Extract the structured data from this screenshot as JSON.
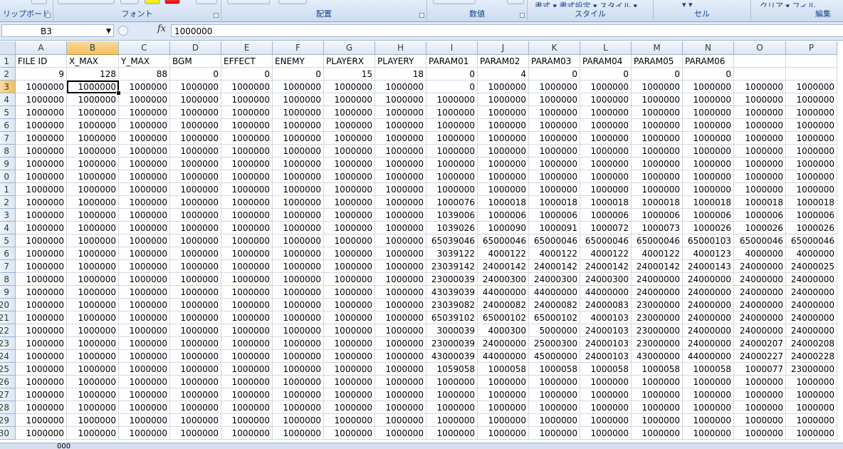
{
  "ribbon": {
    "groups": [
      {
        "label": "リップボード",
        "buttons": ""
      },
      {
        "label": "フォント",
        "buttons": ""
      },
      {
        "label": "配置",
        "buttons": ""
      },
      {
        "label": "数値",
        "buttons": ""
      },
      {
        "label": "スタイル",
        "buttons": "書式 ▾   書式設定 ▾  スタイル ▾"
      },
      {
        "label": "セル",
        "buttons": "▾          ▾"
      },
      {
        "label": "編集",
        "buttons": "クリア ▾          フィル"
      }
    ]
  },
  "formula_bar": {
    "name_box": "B3",
    "fx": "fx",
    "value": "1000000"
  },
  "sheet": {
    "columns": [
      "A",
      "B",
      "C",
      "D",
      "E",
      "F",
      "G",
      "H",
      "I",
      "J",
      "K",
      "L",
      "M",
      "N",
      "O",
      "P"
    ],
    "active_column": "B",
    "active_row": "3",
    "rows": [
      {
        "n": "1",
        "cells": [
          "FILE ID",
          "X_MAX",
          "Y_MAX",
          "BGM",
          "EFFECT",
          "ENEMY",
          "PLAYERX",
          "PLAYERY",
          "PARAM01",
          "PARAM02",
          "PARAM03",
          "PARAM04",
          "PARAM05",
          "PARAM06",
          "",
          ""
        ]
      },
      {
        "n": "2",
        "cells": [
          "9",
          "128",
          "88",
          "0",
          "0",
          "0",
          "15",
          "18",
          "0",
          "4",
          "0",
          "0",
          "0",
          "0",
          "",
          ""
        ]
      },
      {
        "n": "3",
        "cells": [
          "1000000",
          "1000000",
          "1000000",
          "1000000",
          "1000000",
          "1000000",
          "1000000",
          "1000000",
          "0",
          "1000000",
          "1000000",
          "1000000",
          "1000000",
          "1000000",
          "1000000",
          "1000000"
        ]
      },
      {
        "n": "4",
        "cells": [
          "1000000",
          "1000000",
          "1000000",
          "1000000",
          "1000000",
          "1000000",
          "1000000",
          "1000000",
          "1000000",
          "1000000",
          "1000000",
          "1000000",
          "1000000",
          "1000000",
          "1000000",
          "1000000"
        ]
      },
      {
        "n": "5",
        "cells": [
          "1000000",
          "1000000",
          "1000000",
          "1000000",
          "1000000",
          "1000000",
          "1000000",
          "1000000",
          "1000000",
          "1000000",
          "1000000",
          "1000000",
          "1000000",
          "1000000",
          "1000000",
          "1000000"
        ]
      },
      {
        "n": "6",
        "cells": [
          "1000000",
          "1000000",
          "1000000",
          "1000000",
          "1000000",
          "1000000",
          "1000000",
          "1000000",
          "1000000",
          "1000000",
          "1000000",
          "1000000",
          "1000000",
          "1000000",
          "1000000",
          "1000000"
        ]
      },
      {
        "n": "7",
        "cells": [
          "1000000",
          "1000000",
          "1000000",
          "1000000",
          "1000000",
          "1000000",
          "1000000",
          "1000000",
          "1000000",
          "1000000",
          "1000000",
          "1000000",
          "1000000",
          "1000000",
          "1000000",
          "1000000"
        ]
      },
      {
        "n": "8",
        "cells": [
          "1000000",
          "1000000",
          "1000000",
          "1000000",
          "1000000",
          "1000000",
          "1000000",
          "1000000",
          "1000000",
          "1000000",
          "1000000",
          "1000000",
          "1000000",
          "1000000",
          "1000000",
          "1000000"
        ]
      },
      {
        "n": "9",
        "cells": [
          "1000000",
          "1000000",
          "1000000",
          "1000000",
          "1000000",
          "1000000",
          "1000000",
          "1000000",
          "1000000",
          "1000000",
          "1000000",
          "1000000",
          "1000000",
          "1000000",
          "1000000",
          "1000000"
        ]
      },
      {
        "n": "0",
        "cells": [
          "1000000",
          "1000000",
          "1000000",
          "1000000",
          "1000000",
          "1000000",
          "1000000",
          "1000000",
          "1000000",
          "1000000",
          "1000000",
          "1000000",
          "1000000",
          "1000000",
          "1000000",
          "1000000"
        ]
      },
      {
        "n": "1",
        "cells": [
          "1000000",
          "1000000",
          "1000000",
          "1000000",
          "1000000",
          "1000000",
          "1000000",
          "1000000",
          "1000000",
          "1000000",
          "1000000",
          "1000000",
          "1000000",
          "1000000",
          "1000000",
          "1000000"
        ]
      },
      {
        "n": "2",
        "cells": [
          "1000000",
          "1000000",
          "1000000",
          "1000000",
          "1000000",
          "1000000",
          "1000000",
          "1000000",
          "1000076",
          "1000018",
          "1000018",
          "1000018",
          "1000018",
          "1000018",
          "1000018",
          "1000018"
        ]
      },
      {
        "n": "3",
        "cells": [
          "1000000",
          "1000000",
          "1000000",
          "1000000",
          "1000000",
          "1000000",
          "1000000",
          "1000000",
          "1039006",
          "1000006",
          "1000006",
          "1000006",
          "1000006",
          "1000006",
          "1000006",
          "1000006"
        ]
      },
      {
        "n": "4",
        "cells": [
          "1000000",
          "1000000",
          "1000000",
          "1000000",
          "1000000",
          "1000000",
          "1000000",
          "1000000",
          "1039026",
          "1000090",
          "1000091",
          "1000072",
          "1000073",
          "1000026",
          "1000026",
          "1000026"
        ]
      },
      {
        "n": "5",
        "cells": [
          "1000000",
          "1000000",
          "1000000",
          "1000000",
          "1000000",
          "1000000",
          "1000000",
          "1000000",
          "65039046",
          "65000046",
          "65000046",
          "65000046",
          "65000046",
          "65000103",
          "65000046",
          "65000046"
        ]
      },
      {
        "n": "6",
        "cells": [
          "1000000",
          "1000000",
          "1000000",
          "1000000",
          "1000000",
          "1000000",
          "1000000",
          "1000000",
          "3039122",
          "4000122",
          "4000122",
          "4000122",
          "4000122",
          "4000123",
          "4000000",
          "4000000"
        ]
      },
      {
        "n": "7",
        "cells": [
          "1000000",
          "1000000",
          "1000000",
          "1000000",
          "1000000",
          "1000000",
          "1000000",
          "1000000",
          "23039142",
          "24000142",
          "24000142",
          "24000142",
          "24000142",
          "24000143",
          "24000000",
          "24000025"
        ]
      },
      {
        "n": "8",
        "cells": [
          "1000000",
          "1000000",
          "1000000",
          "1000000",
          "1000000",
          "1000000",
          "1000000",
          "1000000",
          "23000039",
          "24000300",
          "24000300",
          "24000300",
          "24000000",
          "24000000",
          "24000000",
          "24000000"
        ]
      },
      {
        "n": "9",
        "cells": [
          "1000000",
          "1000000",
          "1000000",
          "1000000",
          "1000000",
          "1000000",
          "1000000",
          "1000000",
          "43039039",
          "44000000",
          "44000000",
          "44000000",
          "24000000",
          "24000000",
          "24000000",
          "24000000"
        ]
      },
      {
        "n": "20",
        "cells": [
          "1000000",
          "1000000",
          "1000000",
          "1000000",
          "1000000",
          "1000000",
          "1000000",
          "1000000",
          "23039082",
          "24000082",
          "24000082",
          "24000083",
          "23000000",
          "24000000",
          "24000000",
          "24000000"
        ]
      },
      {
        "n": "21",
        "cells": [
          "1000000",
          "1000000",
          "1000000",
          "1000000",
          "1000000",
          "1000000",
          "1000000",
          "1000000",
          "65039102",
          "65000102",
          "65000102",
          "4000103",
          "23000000",
          "24000000",
          "24000000",
          "24000000"
        ]
      },
      {
        "n": "22",
        "cells": [
          "1000000",
          "1000000",
          "1000000",
          "1000000",
          "1000000",
          "1000000",
          "1000000",
          "1000000",
          "3000039",
          "4000300",
          "5000000",
          "24000103",
          "23000000",
          "24000000",
          "24000000",
          "24000000"
        ]
      },
      {
        "n": "23",
        "cells": [
          "1000000",
          "1000000",
          "1000000",
          "1000000",
          "1000000",
          "1000000",
          "1000000",
          "1000000",
          "23000039",
          "24000000",
          "25000300",
          "24000103",
          "23000000",
          "24000000",
          "24000207",
          "24000208"
        ]
      },
      {
        "n": "24",
        "cells": [
          "1000000",
          "1000000",
          "1000000",
          "1000000",
          "1000000",
          "1000000",
          "1000000",
          "1000000",
          "43000039",
          "44000000",
          "45000000",
          "24000103",
          "43000000",
          "44000000",
          "24000227",
          "24000228"
        ]
      },
      {
        "n": "25",
        "cells": [
          "1000000",
          "1000000",
          "1000000",
          "1000000",
          "1000000",
          "1000000",
          "1000000",
          "1000000",
          "1059058",
          "1000058",
          "1000058",
          "1000058",
          "1000058",
          "1000058",
          "1000077",
          "23000000"
        ]
      },
      {
        "n": "26",
        "cells": [
          "1000000",
          "1000000",
          "1000000",
          "1000000",
          "1000000",
          "1000000",
          "1000000",
          "1000000",
          "1000000",
          "1000000",
          "1000000",
          "1000000",
          "1000000",
          "1000000",
          "1000000",
          "1000000"
        ]
      },
      {
        "n": "27",
        "cells": [
          "1000000",
          "1000000",
          "1000000",
          "1000000",
          "1000000",
          "1000000",
          "1000000",
          "1000000",
          "1000000",
          "1000000",
          "1000000",
          "1000000",
          "1000000",
          "1000000",
          "1000000",
          "1000000"
        ]
      },
      {
        "n": "28",
        "cells": [
          "1000000",
          "1000000",
          "1000000",
          "1000000",
          "1000000",
          "1000000",
          "1000000",
          "1000000",
          "1000000",
          "1000000",
          "1000000",
          "1000000",
          "1000000",
          "1000000",
          "1000000",
          "1000000"
        ]
      },
      {
        "n": "29",
        "cells": [
          "1000000",
          "1000000",
          "1000000",
          "1000000",
          "1000000",
          "1000000",
          "1000000",
          "1000000",
          "1000000",
          "1000000",
          "1000000",
          "1000000",
          "1000000",
          "1000000",
          "1000000",
          "1000000"
        ]
      },
      {
        "n": "30",
        "cells": [
          "1000000",
          "1000000",
          "1000000",
          "1000000",
          "1000000",
          "1000000",
          "1000000",
          "1000000",
          "1000000",
          "1000000",
          "1000000",
          "1000000",
          "1000000",
          "1000000",
          "1000000",
          "1000000"
        ]
      }
    ]
  },
  "sheet_tabs": [
    "000"
  ],
  "colors": {
    "selection_border": "#000000",
    "header_active": "#f1c15f",
    "grid_line": "#d0d7e5"
  }
}
